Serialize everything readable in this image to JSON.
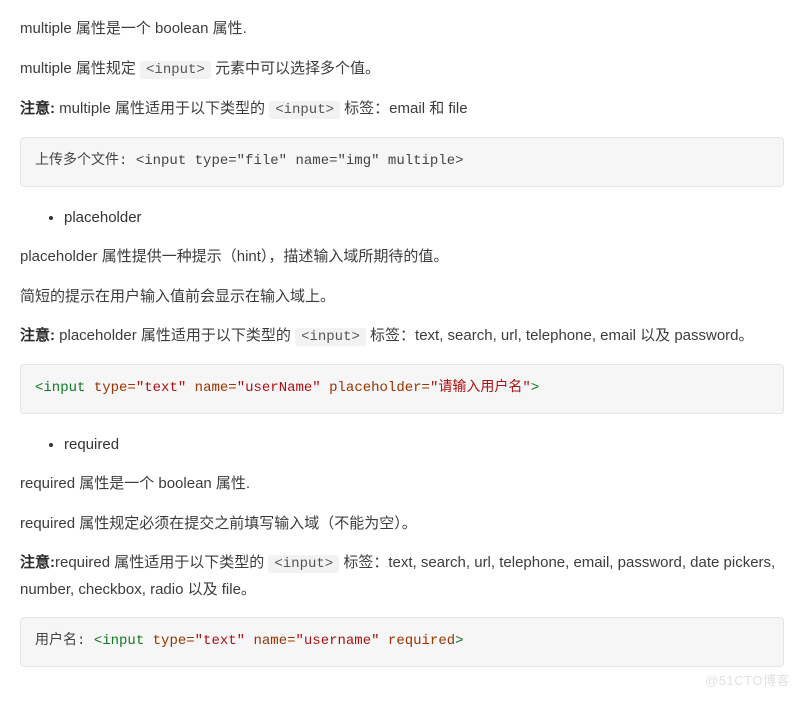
{
  "p1": {
    "seg1": "multiple 属性是一个 boolean 属性."
  },
  "p2": {
    "seg1": "multiple 属性规定 ",
    "code1": "<input>",
    "seg2": " 元素中可以选择多个值。"
  },
  "p3": {
    "bold": "注意:",
    "seg1": " multiple 属性适用于以下类型的 ",
    "code1": "<input>",
    "seg2": " 标签：email 和 file"
  },
  "code1": {
    "lead": "上传多个文件: ",
    "open_br": "<",
    "tag1": "input",
    "sp1": " ",
    "a1": "type=",
    "v1": "\"file\"",
    "sp2": " ",
    "a2": "name=",
    "v2": "\"img\"",
    "sp3": " ",
    "a3": "multiple",
    "close_br": ">"
  },
  "bullet1": "placeholder",
  "p4": {
    "seg1": "placeholder 属性提供一种提示（hint），描述输入域所期待的值。"
  },
  "p5": {
    "seg1": "简短的提示在用户输入值前会显示在输入域上。"
  },
  "p6": {
    "bold": "注意:",
    "seg1": " placeholder 属性适用于以下类型的 ",
    "code1": "<input>",
    "seg2": " 标签：text, search, url, telephone, email 以及 password。"
  },
  "code2": {
    "open_br": "<",
    "tag1": "input",
    "sp1": " ",
    "a1": "type=",
    "v1": "\"text\"",
    "sp2": " ",
    "a2": "name=",
    "v2": "\"userName\"",
    "sp3": " ",
    "a3": "placeholder=",
    "v3": "\"请输入用户名\"",
    "close_br": ">"
  },
  "bullet2": "required",
  "p7": {
    "seg1": "required 属性是一个 boolean 属性."
  },
  "p8": {
    "seg1": "required 属性规定必须在提交之前填写输入域（不能为空）。"
  },
  "p9": {
    "bold": "注意:",
    "seg1": "required 属性适用于以下类型的 ",
    "code1": "<input>",
    "seg2": " 标签：text, search, url, telephone, email, password, date pickers, number, checkbox, radio 以及 file。"
  },
  "code3": {
    "lead": "用户名: ",
    "open_br": "<",
    "tag1": "input",
    "sp1": " ",
    "a1": "type=",
    "v1": "\"text\"",
    "sp2": " ",
    "a2": "name=",
    "v2": "\"username\"",
    "sp3": " ",
    "a3": "required",
    "close_br": ">"
  },
  "watermark": "@51CTO博客"
}
